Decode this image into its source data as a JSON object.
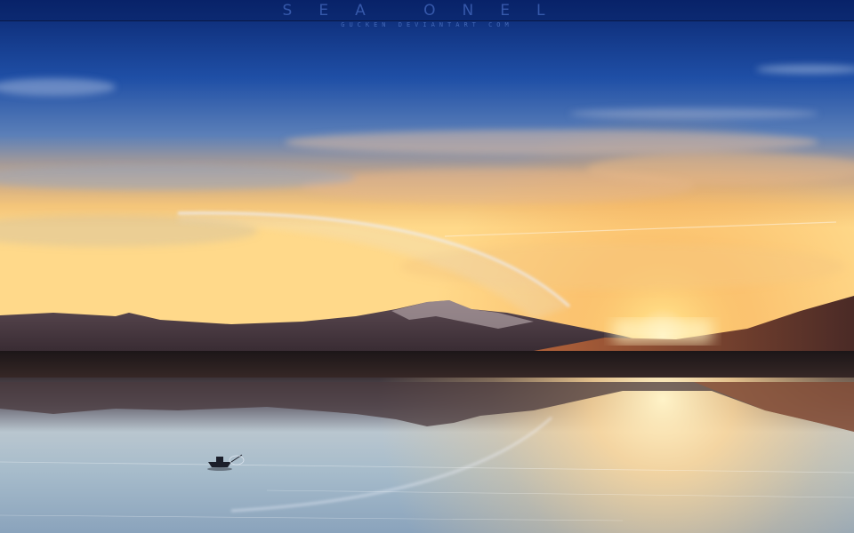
{
  "header": {
    "title": "SEA ONEL",
    "subtitle": "GUCKEN DEVIANTART COM"
  },
  "palette": {
    "sky_top": "#0b2a74",
    "sky_mid": "#2d63b8",
    "horizon_glow": "#ffd27a",
    "sun": "#fff2c4",
    "mountain": "#3a2e3a",
    "water": "#f2d7a3"
  }
}
